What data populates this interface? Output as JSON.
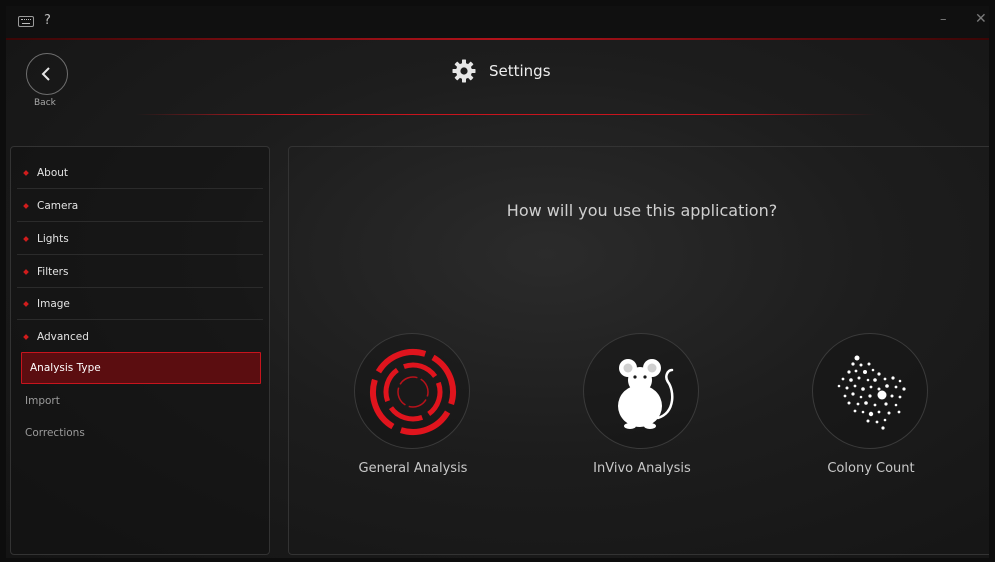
{
  "titlebar": {
    "keyboard_icon": "keyboard-icon",
    "help_label": "?",
    "minimize_label": "–",
    "close_label": "✕",
    "accent_color": "#b3121a"
  },
  "header": {
    "back_label": "Back",
    "title": "Settings",
    "title_icon": "gear-icon"
  },
  "sidebar": {
    "items": [
      {
        "label": "About"
      },
      {
        "label": "Camera"
      },
      {
        "label": "Lights"
      },
      {
        "label": "Filters"
      },
      {
        "label": "Image"
      },
      {
        "label": "Advanced"
      }
    ],
    "subitems": [
      {
        "label": "Analysis Type",
        "selected": true
      },
      {
        "label": "Import"
      },
      {
        "label": "Corrections"
      }
    ]
  },
  "main": {
    "question": "How will you use this application?",
    "options": [
      {
        "label": "General Analysis",
        "icon": "target-rings-icon"
      },
      {
        "label": "InVivo Analysis",
        "icon": "mouse-icon"
      },
      {
        "label": "Colony Count",
        "icon": "colony-dots-icon"
      }
    ]
  },
  "colors": {
    "accent_red": "#c8141d",
    "selected_bg": "#5b0d10",
    "background": "#1d1d1d"
  }
}
